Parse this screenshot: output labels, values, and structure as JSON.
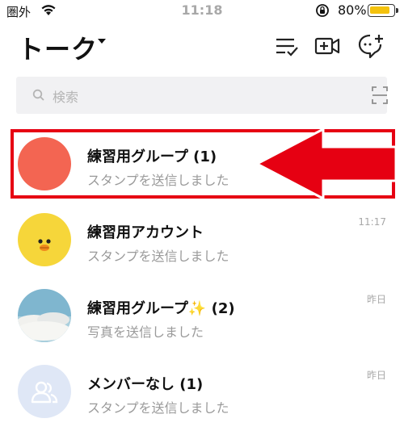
{
  "status": {
    "carrier": "圏外",
    "time": "11:18",
    "battery": "80%",
    "battery_level": 0.8
  },
  "header": {
    "title": "トーク"
  },
  "search": {
    "placeholder": "検索"
  },
  "chats": [
    {
      "name": "練習用グループ (1)",
      "message": "スタンプを送信しました",
      "time": ""
    },
    {
      "name": "練習用アカウント",
      "message": "スタンプを送信しました",
      "time": "11:17"
    },
    {
      "name": "練習用グループ✨ (2)",
      "message": "写真を送信しました",
      "time": "昨日"
    },
    {
      "name": "メンバーなし (1)",
      "message": "スタンプを送信しました",
      "time": "昨日"
    }
  ],
  "colors": {
    "annotation": "#e60012",
    "group_avatar": "#f36552",
    "sally_avatar": "#f6d63a",
    "member_avatar": "#dfe7f6"
  }
}
